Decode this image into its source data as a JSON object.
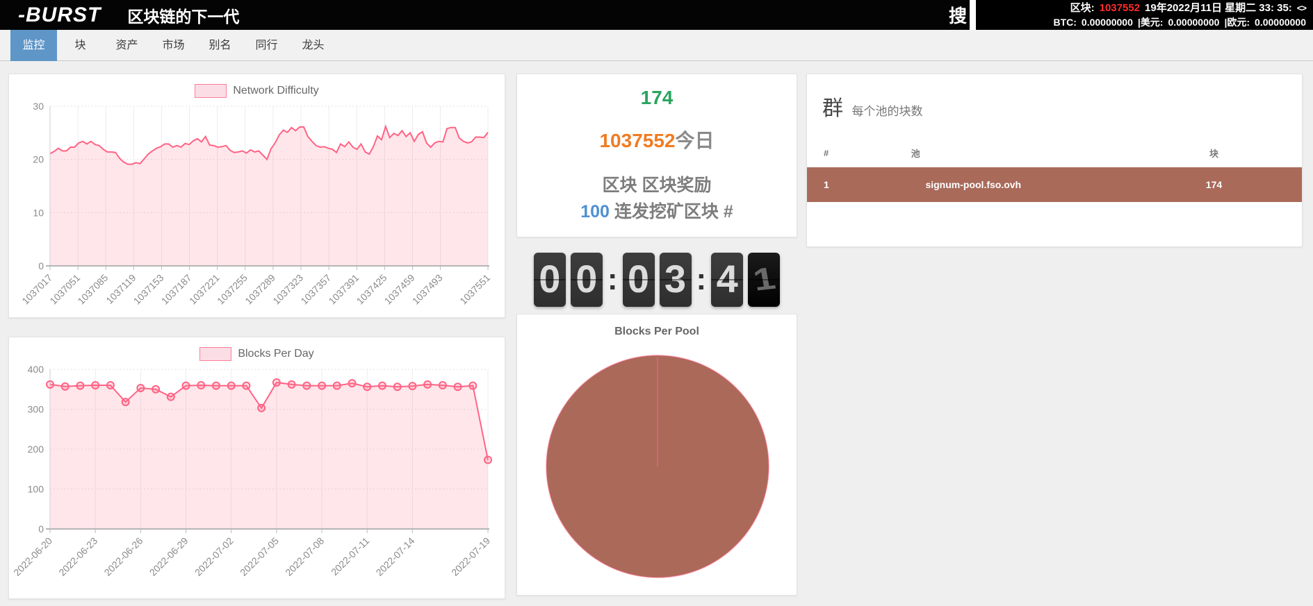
{
  "header": {
    "logo": "-BURST",
    "title": "区块链的下一代",
    "search_label": "搜",
    "info": {
      "block_label": "区块:",
      "block_value": "1037552",
      "datetime": "19年2022月11日 星期二 33: 35:",
      "expand_icon": "<>",
      "btc_label": "BTC:",
      "btc_value": "0.00000000",
      "usd_label": "|美元:",
      "usd_value": "0.00000000",
      "eur_label": "|欧元:",
      "eur_value": "0.00000000"
    }
  },
  "nav": {
    "tabs": [
      {
        "label": "监控",
        "active": true
      },
      {
        "label": "块",
        "active": false
      },
      {
        "label": "资产",
        "active": false
      },
      {
        "label": "市场",
        "active": false
      },
      {
        "label": "别名",
        "active": false
      },
      {
        "label": "同行",
        "active": false
      },
      {
        "label": "龙头",
        "active": false
      }
    ]
  },
  "stats": {
    "blocks_today": "174",
    "height_value": "1037552",
    "height_suffix": "今日",
    "line3": "区块 区块奖励",
    "reward_value": "100",
    "line4_rest": "连发挖矿区块 #"
  },
  "clock": {
    "digits": [
      "0",
      "0",
      ":",
      "0",
      "3",
      ":",
      "4",
      "1"
    ]
  },
  "pools_panel": {
    "title_main": "群",
    "title_sub": "每个池的块数",
    "columns": [
      "#",
      "池",
      "块"
    ],
    "rows": [
      [
        "1",
        "signum-pool.fso.ovh",
        "174"
      ]
    ]
  },
  "chart_data": [
    {
      "type": "area",
      "title": "Network Difficulty",
      "x_start": 1037017,
      "x_end": 1037551,
      "ylim": [
        0,
        30
      ],
      "yticks": [
        0,
        10,
        20,
        30
      ],
      "tick_values": [
        1037017,
        1037051,
        1037085,
        1037119,
        1037153,
        1037187,
        1037221,
        1037255,
        1037289,
        1037323,
        1037357,
        1037391,
        1037425,
        1037459,
        1037493,
        1037551
      ],
      "values": [
        21.1,
        21.5,
        22.1,
        21.6,
        21.6,
        22.3,
        22.3,
        23.1,
        23.4,
        22.9,
        23.4,
        22.8,
        22.6,
        21.9,
        21.4,
        21.4,
        21.3,
        20.2,
        19.5,
        19.1,
        19.1,
        19.4,
        19.2,
        20.1,
        21.0,
        21.6,
        22.1,
        22.4,
        22.9,
        22.9,
        22.3,
        22.6,
        22.3,
        23.0,
        22.8,
        23.5,
        23.9,
        23.3,
        24.3,
        22.7,
        22.6,
        22.3,
        22.4,
        22.6,
        21.7,
        21.3,
        21.4,
        21.6,
        21.2,
        21.8,
        21.4,
        21.6,
        20.8,
        20.0,
        22.0,
        23.1,
        24.6,
        25.5,
        25.1,
        26.0,
        25.4,
        26.1,
        26.1,
        24.3,
        23.4,
        22.6,
        22.3,
        22.4,
        22.1,
        21.9,
        21.3,
        22.9,
        22.4,
        23.3,
        22.3,
        21.9,
        22.9,
        21.4,
        21.0,
        22.4,
        24.4,
        23.7,
        26.2,
        24.1,
        24.9,
        24.5,
        25.4,
        24.3,
        25.0,
        23.4,
        24.7,
        25.2,
        23.1,
        22.3,
        23.1,
        23.4,
        23.3,
        25.8,
        26.0,
        26.0,
        24.0,
        23.4,
        23.1,
        23.3,
        24.2,
        24.2,
        24.1,
        25.1
      ]
    },
    {
      "type": "area",
      "title": "Blocks Per Day",
      "categories": [
        "2022-06-20",
        "2022-06-21",
        "2022-06-22",
        "2022-06-23",
        "2022-06-24",
        "2022-06-25",
        "2022-06-26",
        "2022-06-27",
        "2022-06-28",
        "2022-06-29",
        "2022-06-30",
        "2022-07-01",
        "2022-07-02",
        "2022-07-03",
        "2022-07-04",
        "2022-07-05",
        "2022-07-06",
        "2022-07-07",
        "2022-07-08",
        "2022-07-09",
        "2022-07-10",
        "2022-07-11",
        "2022-07-12",
        "2022-07-13",
        "2022-07-14",
        "2022-07-15",
        "2022-07-16",
        "2022-07-17",
        "2022-07-18",
        "2022-07-19"
      ],
      "values": [
        362,
        357,
        359,
        360,
        360,
        318,
        353,
        350,
        331,
        359,
        360,
        359,
        359,
        359,
        303,
        367,
        362,
        359,
        359,
        359,
        365,
        356,
        359,
        356,
        358,
        362,
        360,
        356,
        359,
        173
      ],
      "ylim": [
        0,
        400
      ],
      "yticks": [
        0,
        100,
        200,
        300,
        400
      ],
      "tick_indices": [
        0,
        3,
        6,
        9,
        12,
        15,
        18,
        21,
        24,
        29
      ],
      "points": true
    },
    {
      "type": "pie",
      "title": "Blocks Per Pool",
      "labels": [
        "signum-pool.fso.ovh"
      ],
      "values": [
        174
      ]
    }
  ],
  "colors": {
    "accent_pink": "#ff6384",
    "pink_fill": "rgba(255,99,132,0.16)",
    "point_fill": "rgba(255,99,132,0.22)",
    "pie_fill": "#ab695a",
    "row_brown": "#a96a5a",
    "active_tab": "#5e96c8",
    "green": "#2aa45f",
    "orange": "#f07c22",
    "blue": "#4f90d1",
    "red": "#ff2c2c"
  }
}
